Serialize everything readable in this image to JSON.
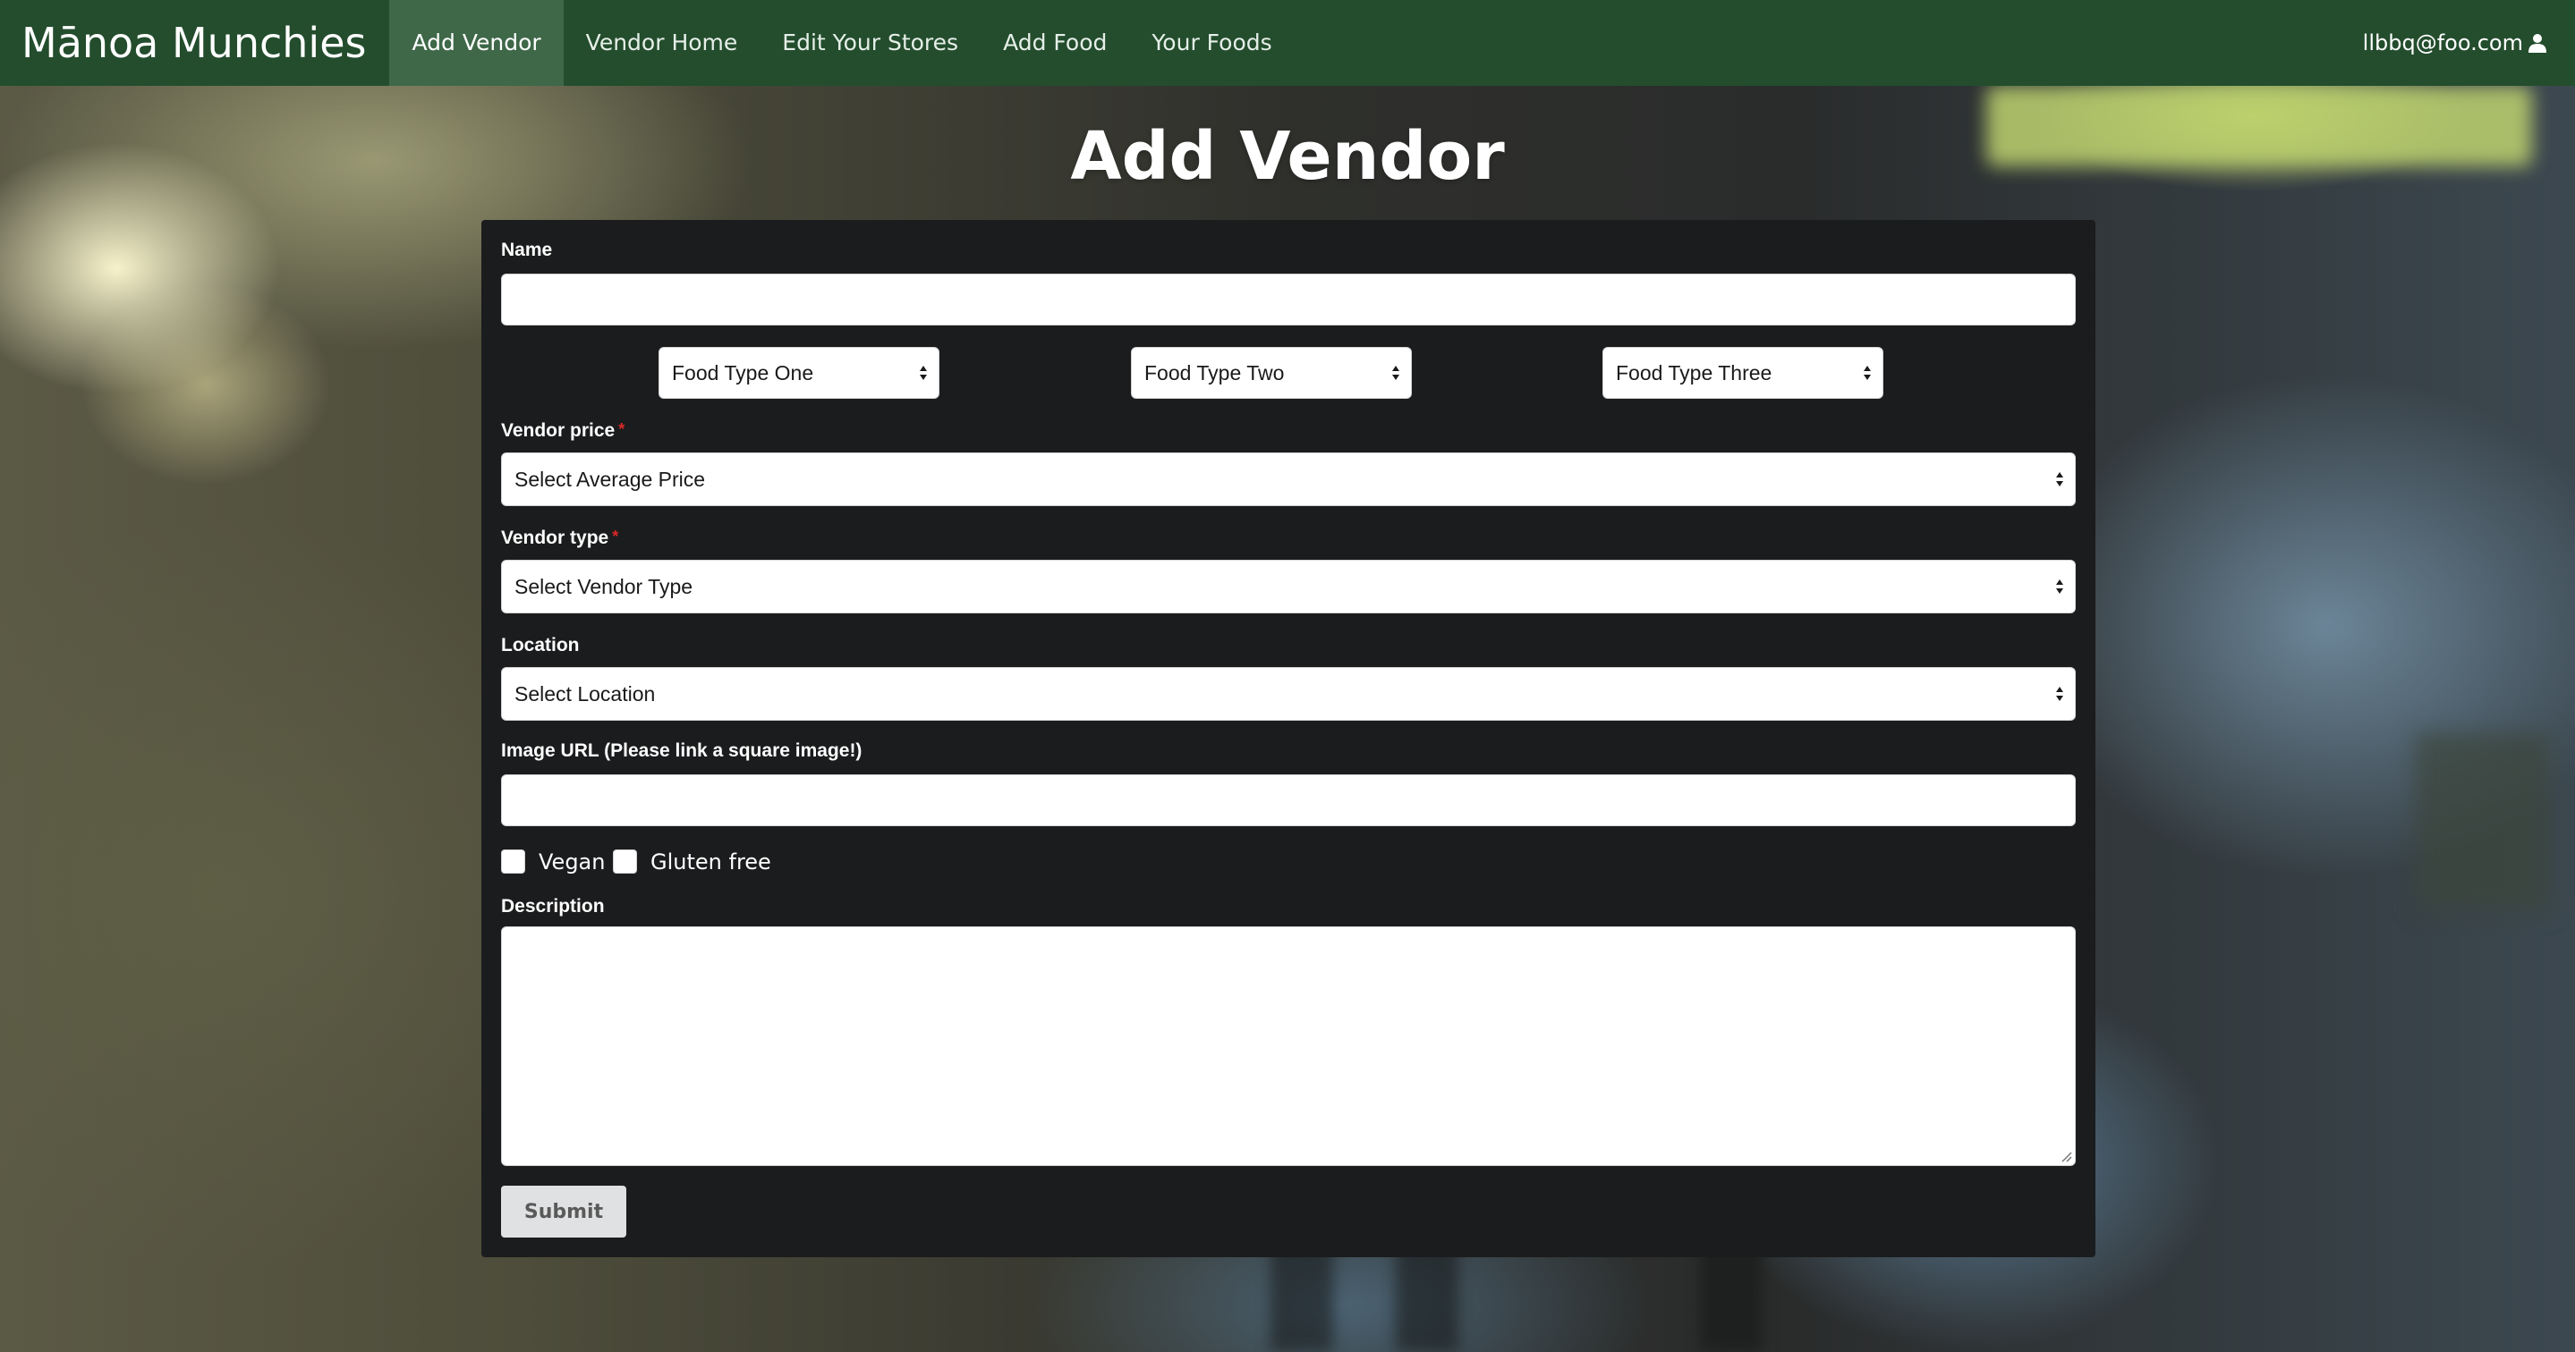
{
  "navbar": {
    "brand": "Mānoa Munchies",
    "items": [
      {
        "label": "Add Vendor",
        "active": true
      },
      {
        "label": "Vendor Home"
      },
      {
        "label": "Edit Your Stores"
      },
      {
        "label": "Add Food"
      },
      {
        "label": "Your Foods"
      }
    ],
    "user_email": "llbbq@foo.com",
    "user_icon": "user-icon"
  },
  "page": {
    "title": "Add Vendor"
  },
  "form": {
    "name_label": "Name",
    "name_value": "",
    "food_types": [
      "Food Type One",
      "Food Type Two",
      "Food Type Three"
    ],
    "price_label": "Vendor price",
    "price_selected": "Select Average Price",
    "type_label": "Vendor type",
    "type_selected": "Select Vendor Type",
    "required_marker": "*",
    "location_label": "Location",
    "location_selected": "Select Location",
    "image_label": "Image URL (Please link a square image!)",
    "image_value": "",
    "vegan_label": "Vegan",
    "vegan_checked": false,
    "gluten_label": "Gluten free",
    "gluten_checked": false,
    "description_label": "Description",
    "description_value": "",
    "submit_label": "Submit"
  },
  "colors": {
    "navbar": "#234d2d",
    "navbar_active": "#3e6848",
    "panel": "#1b1c1d",
    "required": "#db2828",
    "submit_bg": "#e0e1e2"
  }
}
